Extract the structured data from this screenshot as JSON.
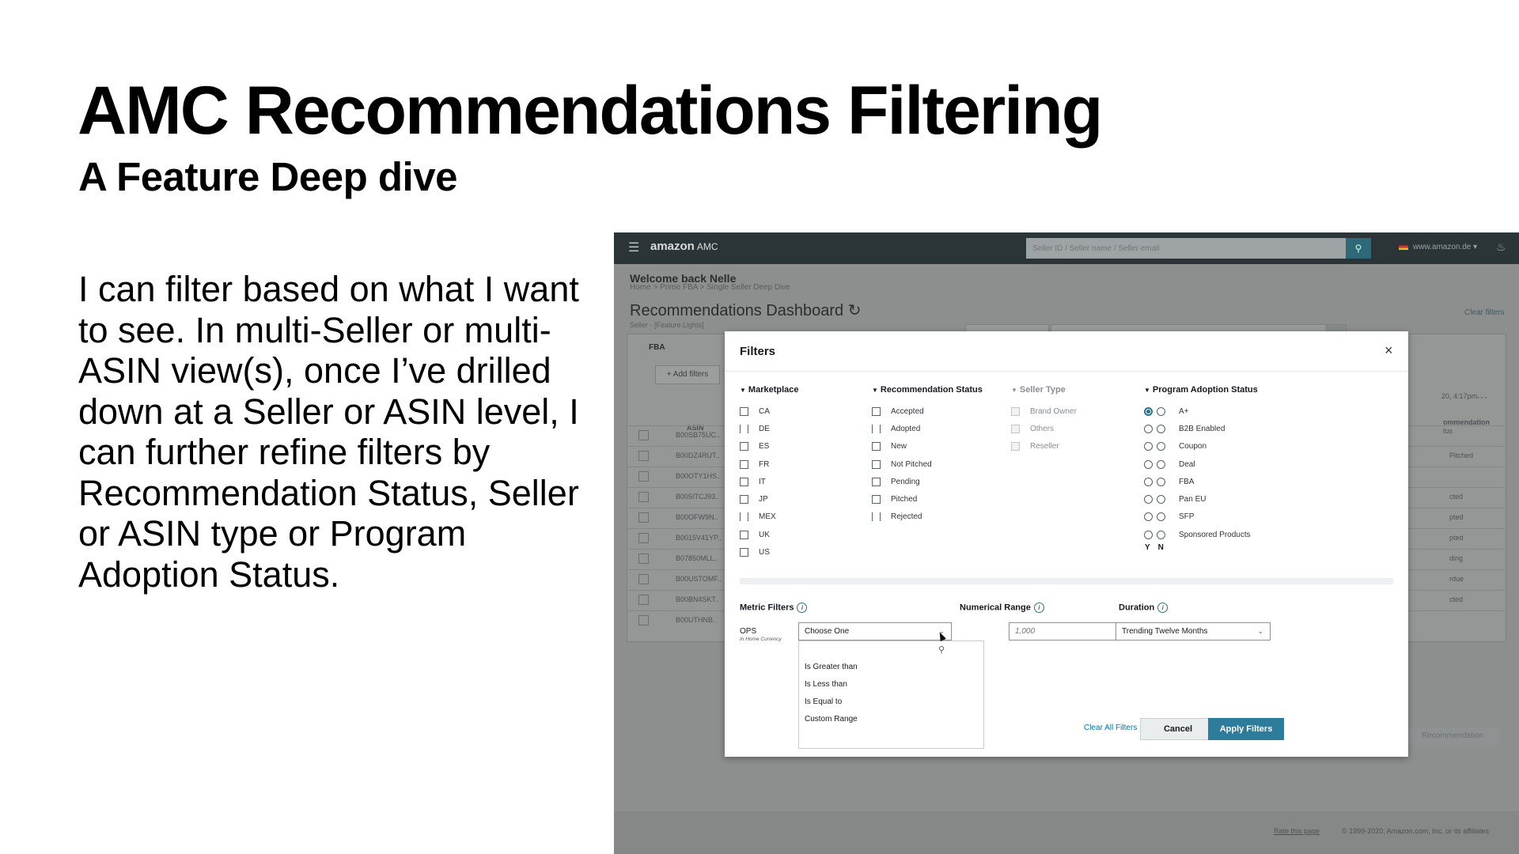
{
  "slide": {
    "title": "AMC Recommendations Filtering",
    "subtitle": "A Feature Deep dive",
    "body": "I can filter based on what I want to see. In multi-Seller or multi-ASIN view(s), once I’ve drilled down at a Seller or ASIN level, I can further refine filters by Recommendation Status, Seller or ASIN type or Program Adoption Status."
  },
  "app": {
    "logo": "amazon",
    "logo_suffix": "AMC",
    "search_placeholder": "Seller ID / Seller name / Seller email",
    "store": "www.amazon.de",
    "welcome": "Welcome back Nelle",
    "breadcrumb": "Home  >  Prime FBA  >  Single Seller Deep Dive",
    "dashboard_title": "Recommendations Dashboard",
    "dashboard_sub": "Seller - [Feature Lights]",
    "clear_filters": "Clear filters",
    "tab": "FBA",
    "add_filters": "+ Add filters",
    "asin_header": "ASIN",
    "recommendation_header": "ommendation",
    "recommendation_sub": "tus",
    "time": "20, 4:17pm",
    "rows": [
      {
        "asin": "B00SB75UC..",
        "status": ""
      },
      {
        "asin": "B00DZ4RUT..",
        "status": "Pitched"
      },
      {
        "asin": "B00OTY1HS..",
        "status": ""
      },
      {
        "asin": "B005ITCJ93..",
        "status": "cted"
      },
      {
        "asin": "B00OFW9N..",
        "status": "pted"
      },
      {
        "asin": "B0015V41YP..",
        "status": "pted"
      },
      {
        "asin": "B07850MLL..",
        "status": "ding"
      },
      {
        "asin": "B00USTOMF..",
        "status": "rdue"
      },
      {
        "asin": "B00BN4SKT..",
        "status": "cted"
      },
      {
        "asin": "B00UTHNB..",
        "status": ""
      }
    ],
    "bg_button": "Recommendation",
    "footer_link": "Rate this page",
    "footer_copy": "© 1999-2020, Amazon.com, Inc. or its affiliates"
  },
  "filters": {
    "title": "Filters",
    "close": "×",
    "groups": {
      "marketplace": {
        "title": "Marketplace",
        "options": [
          "CA",
          "DE",
          "ES",
          "FR",
          "IT",
          "JP",
          "MEX",
          "UK",
          "US"
        ]
      },
      "recommendation_status": {
        "title": "Recommendation Status",
        "options": [
          "Accepted",
          "Adopted",
          "New",
          "Not Pitched",
          "Pending",
          "Pitched",
          "Rejected"
        ]
      },
      "seller_type": {
        "title": "Seller Type",
        "options": [
          "Brand Owner",
          "Others",
          "Reseller"
        ]
      },
      "program_adoption": {
        "title": "Program Adoption Status",
        "options": [
          "A+",
          "B2B Enabled",
          "Coupon",
          "Deal",
          "FBA",
          "Pan EU",
          "SFP",
          "Sponsored Products"
        ],
        "yes_label": "Y",
        "no_label": "N"
      }
    },
    "metric_filters_label": "Metric Filters",
    "numerical_range_label": "Numerical Range",
    "duration_label": "Duration",
    "metric_name": "OPS",
    "metric_currency": "In Home Currency",
    "operator_select": "Choose One",
    "operator_options": [
      "Is Greater than",
      "Is Less than",
      "Is Equal to",
      "Custom Range"
    ],
    "range_placeholder": "1,000",
    "duration_value": "Trending Twelve Months",
    "clear_all": "Clear All Filters",
    "cancel": "Cancel",
    "apply": "Apply Filters"
  }
}
